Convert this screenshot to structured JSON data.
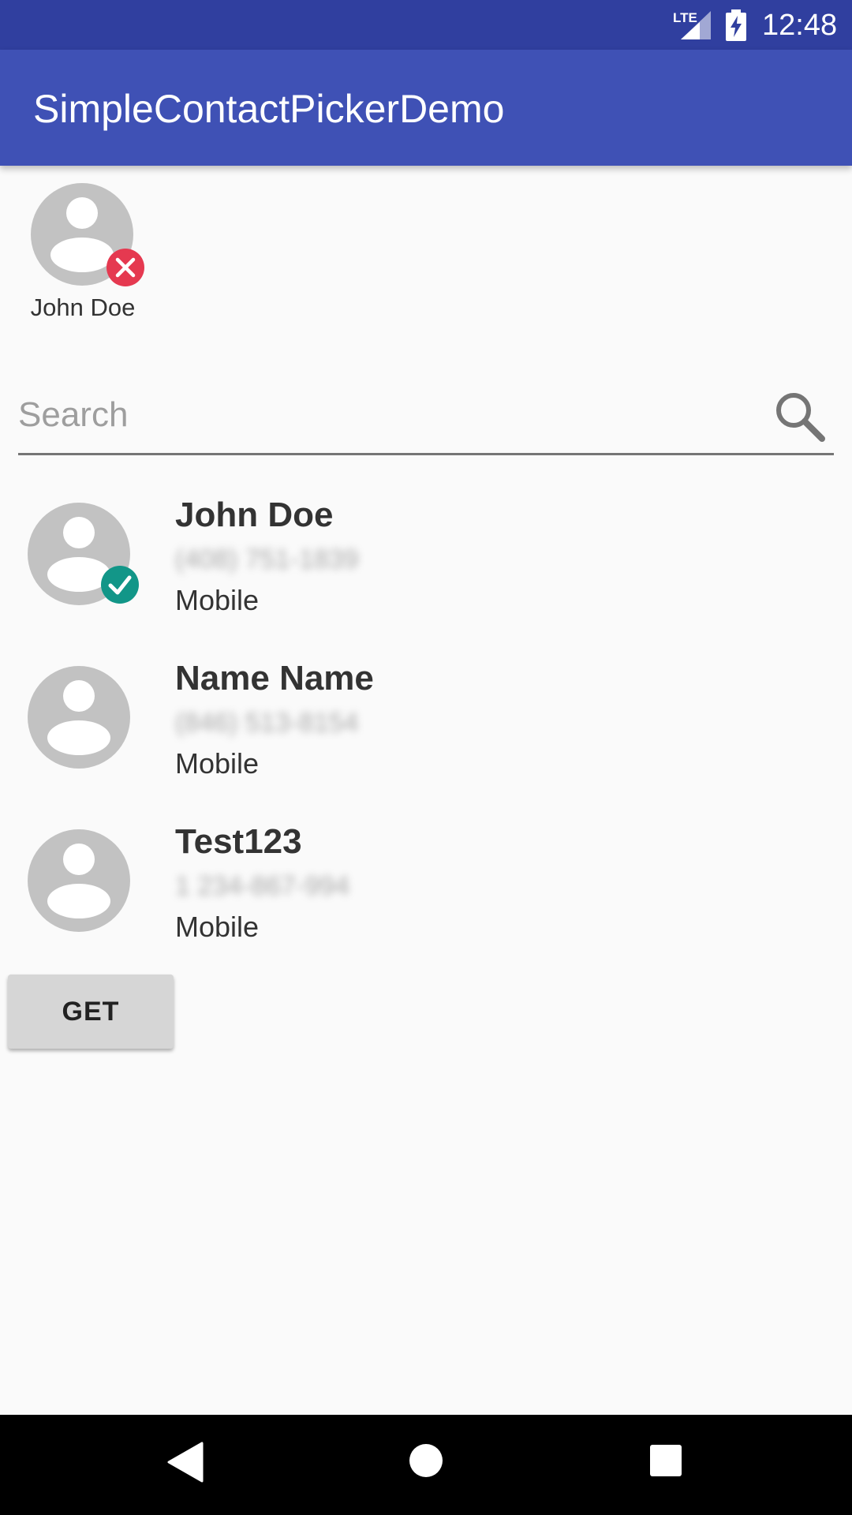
{
  "status_bar": {
    "network": "LTE",
    "time": "12:48"
  },
  "app_bar": {
    "title": "SimpleContactPickerDemo"
  },
  "selected": [
    {
      "name": "John Doe",
      "badge": "remove-icon"
    }
  ],
  "search": {
    "placeholder": "Search",
    "value": ""
  },
  "contacts": [
    {
      "name": "John Doe",
      "phone": "(408) 751-1839",
      "type": "Mobile",
      "selected": true
    },
    {
      "name": "Name Name",
      "phone": "(846) 513-8154",
      "type": "Mobile",
      "selected": false
    },
    {
      "name": "Test123",
      "phone": "1 234-867-994",
      "type": "Mobile",
      "selected": false
    }
  ],
  "actions": {
    "get_label": "GET"
  },
  "colors": {
    "status_bar": "#303f9f",
    "app_bar": "#3f51b5",
    "avatar": "#c2c2c2",
    "remove_badge": "#e53950",
    "check_badge": "#129688"
  }
}
